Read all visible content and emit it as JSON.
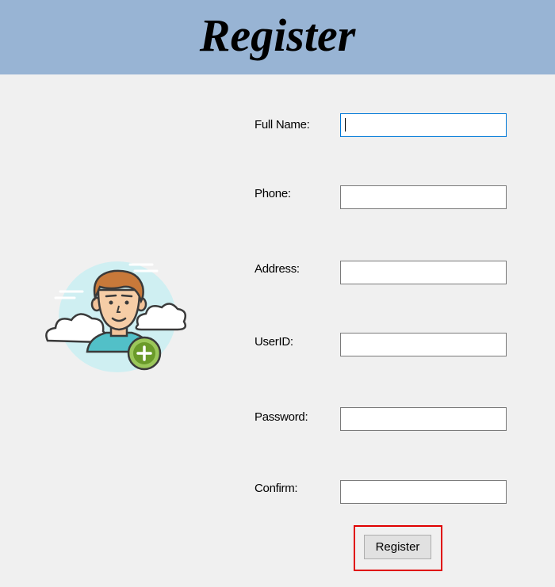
{
  "header": {
    "title": "Register"
  },
  "form": {
    "fields": [
      {
        "label": "Full Name:",
        "value": ""
      },
      {
        "label": "Phone:",
        "value": ""
      },
      {
        "label": "Address:",
        "value": ""
      },
      {
        "label": "UserID:",
        "value": ""
      },
      {
        "label": "Password:",
        "value": ""
      },
      {
        "label": "Confirm:",
        "value": ""
      }
    ],
    "submit_label": "Register"
  },
  "icons": {
    "avatar": "user-add-icon"
  },
  "colors": {
    "header_bg": "#98b4d4",
    "window_bg": "#f0f0f0",
    "focus_border": "#0078d7",
    "highlight_frame": "#e00000",
    "add_badge": "#6a9a2a"
  }
}
